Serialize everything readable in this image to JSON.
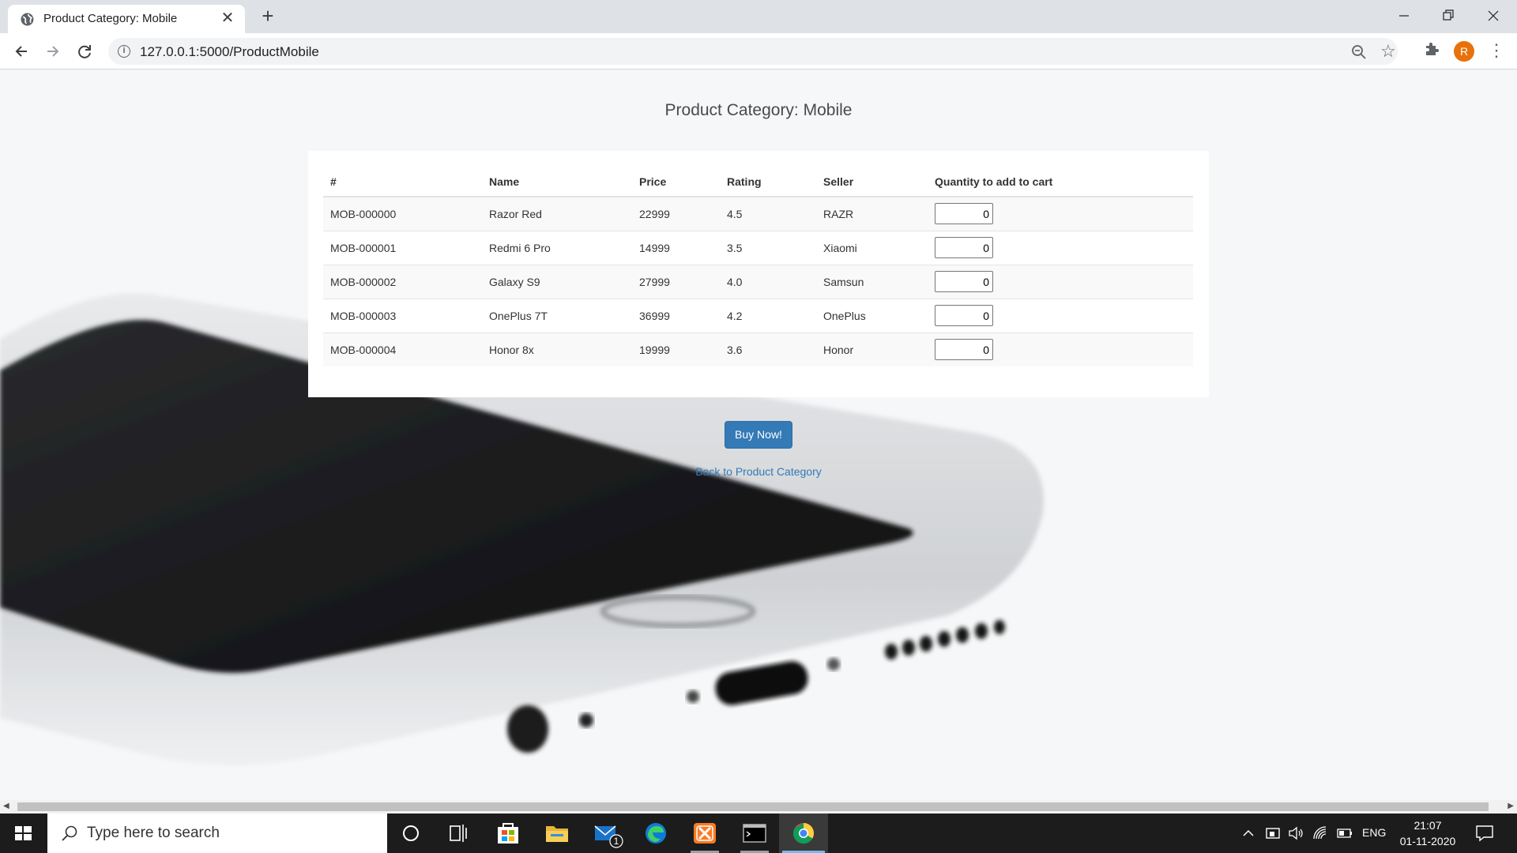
{
  "browser": {
    "tab_title": "Product Category: Mobile",
    "tab_close": "✕",
    "new_tab": "+",
    "url": "127.0.0.1:5000/ProductMobile",
    "profile_initial": "R"
  },
  "page": {
    "title": "Product Category: Mobile",
    "table": {
      "headers": [
        "#",
        "Name",
        "Price",
        "Rating",
        "Seller",
        "Quantity to add to cart"
      ],
      "rows": [
        {
          "id": "MOB-000000",
          "name": "Razor Red",
          "price": "22999",
          "rating": "4.5",
          "seller": "RAZR",
          "qty": "0"
        },
        {
          "id": "MOB-000001",
          "name": "Redmi 6 Pro",
          "price": "14999",
          "rating": "3.5",
          "seller": "Xiaomi",
          "qty": "0"
        },
        {
          "id": "MOB-000002",
          "name": "Galaxy S9",
          "price": "27999",
          "rating": "4.0",
          "seller": "Samsun",
          "qty": "0"
        },
        {
          "id": "MOB-000003",
          "name": "OnePlus 7T",
          "price": "36999",
          "rating": "4.2",
          "seller": "OnePlus",
          "qty": "0"
        },
        {
          "id": "MOB-000004",
          "name": "Honor 8x",
          "price": "19999",
          "rating": "3.6",
          "seller": "Honor",
          "qty": "0"
        }
      ]
    },
    "buy_button": "Buy Now!",
    "back_link": "Back to Product Category"
  },
  "taskbar": {
    "search_placeholder": "Type here to search",
    "mail_badge": "1",
    "language": "ENG",
    "time": "21:07",
    "date": "01-11-2020"
  },
  "colors": {
    "accent": "#337ab7",
    "profile": "#e8710a",
    "taskbar": "#1c1c1c"
  }
}
